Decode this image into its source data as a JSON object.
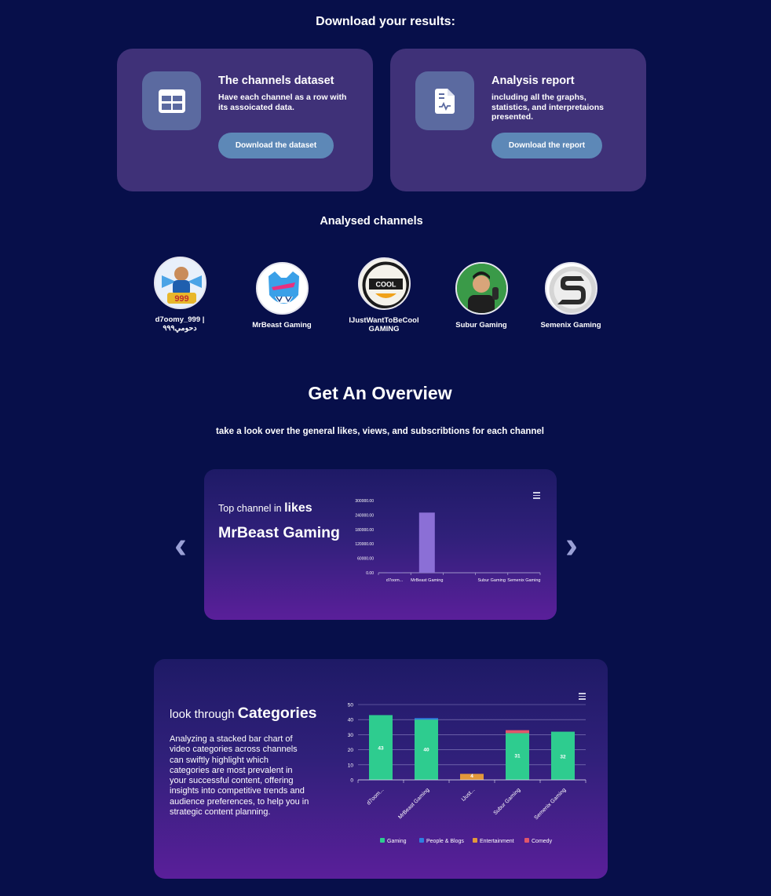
{
  "download": {
    "heading": "Download your results:",
    "cards": [
      {
        "title": "The channels dataset",
        "description": "Have each channel as a row with its assoicated data.",
        "button": "Download the dataset",
        "icon": "table-icon"
      },
      {
        "title": "Analysis report",
        "description": "including all the graphs, statistics, and interpretaions presented.",
        "button": "Download the report",
        "icon": "report-document-icon"
      }
    ]
  },
  "analysed": {
    "heading": "Analysed channels",
    "channels": [
      {
        "name": "d7oomy_999 | دحومي٩٩٩"
      },
      {
        "name": "MrBeast Gaming"
      },
      {
        "name": "IJustWantToBeCool GAMING"
      },
      {
        "name": "Subur Gaming"
      },
      {
        "name": "Semenix Gaming"
      }
    ]
  },
  "overview": {
    "heading": "Get An Overview",
    "subtitle": "take a look over the general likes, views, and subscribtions for each channel",
    "carousel": {
      "label_prefix": "Top channel in",
      "label_metric": "likes",
      "top_channel": "MrBeast Gaming",
      "prev_arrow": "‹",
      "next_arrow": "›"
    }
  },
  "categories_panel": {
    "heading_prefix": "look through",
    "heading_strong": "Categories",
    "description": "Analyzing a stacked bar chart of video categories across channels can swiftly highlight which categories are most prevalent in your successful content, offering insights into competitive trends and audience preferences, to help you in strategic content planning."
  },
  "chart_data": [
    {
      "type": "bar",
      "categories": [
        "d7oom...",
        "MrBeast Gaming",
        "",
        "Subur Gaming",
        "Semenix Gaming"
      ],
      "values": [
        2000,
        250000,
        0,
        0,
        0
      ],
      "ylim": [
        0,
        300000
      ],
      "yticks": [
        "300000.00",
        "240000.00",
        "180000.00",
        "120000.00",
        "60000.00",
        "0.00"
      ],
      "color": "#8b6fd6"
    },
    {
      "type": "bar",
      "stacked": true,
      "categories": [
        "d7oom...",
        "MrBeast Gaming",
        "IJust...",
        "Subur Gaming",
        "Semenix Gaming"
      ],
      "series": [
        {
          "name": "Gaming",
          "color": "#2ecc8f",
          "values": [
            43,
            40,
            0,
            31,
            32
          ]
        },
        {
          "name": "People & Blogs",
          "color": "#2f7fe0",
          "values": [
            0,
            1,
            0,
            0,
            0
          ]
        },
        {
          "name": "Entertainment",
          "color": "#e3983a",
          "values": [
            0,
            0,
            4,
            0,
            0
          ]
        },
        {
          "name": "Comedy",
          "color": "#e0566a",
          "values": [
            0,
            0,
            0,
            2,
            0
          ]
        }
      ],
      "data_labels": [
        "43",
        "40",
        "4",
        "31",
        "32"
      ],
      "ylim": [
        0,
        50
      ],
      "yticks": [
        "50",
        "40",
        "30",
        "20",
        "10",
        "0"
      ],
      "legend": "bottom"
    }
  ]
}
